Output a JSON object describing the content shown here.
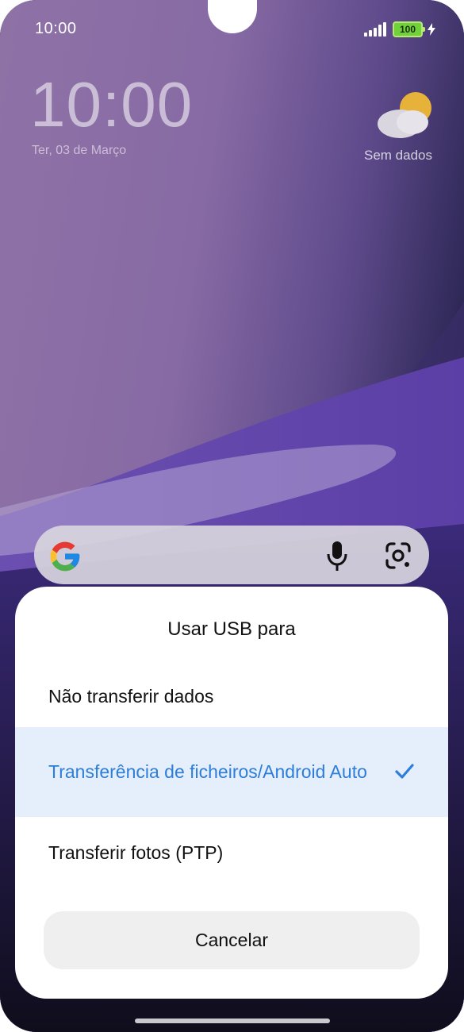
{
  "status_bar": {
    "time": "10:00",
    "battery_level": "100",
    "signal_icon": "signal-bars-icon",
    "charging_icon": "lightning-icon"
  },
  "lock_screen": {
    "clock": "10:00",
    "date": "Ter, 03 de Março",
    "weather_text": "Sem dados",
    "weather_icon": "partly-cloudy-icon"
  },
  "search_bar": {
    "logo_icon": "google-g-icon",
    "mic_icon": "microphone-icon",
    "lens_icon": "google-lens-icon"
  },
  "usb_dialog": {
    "title": "Usar USB para",
    "options": [
      {
        "label": "Não transferir dados",
        "selected": false
      },
      {
        "label": "Transferência de ficheiros/Android Auto",
        "selected": true
      },
      {
        "label": "Transferir fotos (PTP)",
        "selected": false
      }
    ],
    "selected_icon": "checkmark-icon",
    "cancel_label": "Cancelar"
  },
  "colors": {
    "accent": "#2d7ed9",
    "selected_row_bg": "#e5eefb",
    "battery_green": "#6fd23a"
  }
}
